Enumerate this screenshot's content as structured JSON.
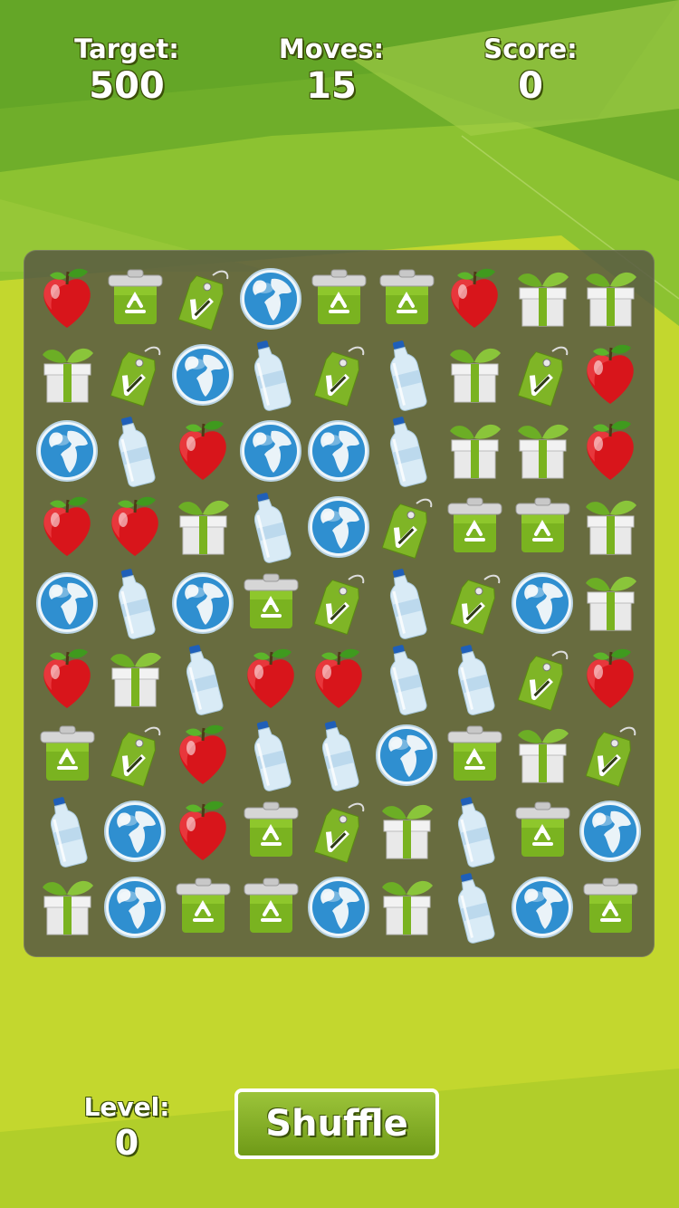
{
  "hud": {
    "target_label": "Target:",
    "target_value": "500",
    "moves_label": "Moves:",
    "moves_value": "15",
    "score_label": "Score:",
    "score_value": "0"
  },
  "level": {
    "label": "Level:",
    "value": "0"
  },
  "shuffle_label": "Shuffle",
  "colors": {
    "background": "#c3d72e",
    "board": "#585a42",
    "accent": "#7ba321"
  },
  "board": {
    "rows": 9,
    "cols": 9,
    "grid": [
      [
        "apple",
        "bin",
        "tag",
        "globe",
        "bin",
        "bin",
        "apple",
        "gift",
        "gift"
      ],
      [
        "gift",
        "tag",
        "globe",
        "bottle",
        "tag",
        "bottle",
        "gift",
        "tag",
        "apple"
      ],
      [
        "globe",
        "bottle",
        "apple",
        "globe",
        "globe",
        "bottle",
        "gift",
        "gift",
        "apple"
      ],
      [
        "apple",
        "apple",
        "gift",
        "bottle",
        "globe",
        "tag",
        "bin",
        "bin",
        "gift"
      ],
      [
        "globe",
        "bottle",
        "globe",
        "bin",
        "tag",
        "bottle",
        "tag",
        "globe",
        "gift"
      ],
      [
        "apple",
        "gift",
        "bottle",
        "apple",
        "apple",
        "bottle",
        "bottle",
        "tag",
        "apple"
      ],
      [
        "bin",
        "tag",
        "apple",
        "bottle",
        "bottle",
        "globe",
        "bin",
        "gift",
        "tag"
      ],
      [
        "bottle",
        "globe",
        "apple",
        "bin",
        "tag",
        "gift",
        "bottle",
        "bin",
        "globe"
      ],
      [
        "gift",
        "globe",
        "bin",
        "bin",
        "globe",
        "gift",
        "bottle",
        "globe",
        "bin"
      ]
    ]
  }
}
